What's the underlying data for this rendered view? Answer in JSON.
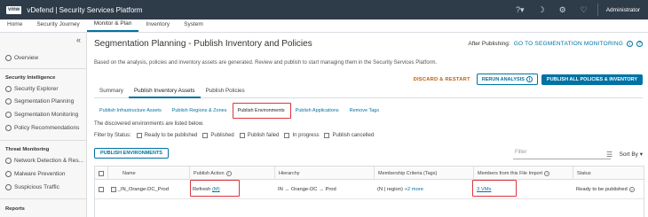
{
  "topbar": {
    "logo": "vmw",
    "title": "vDefend | Security Services Platform",
    "user": "Administrator"
  },
  "nav": {
    "tabs": [
      "Home",
      "Security Journey",
      "Monitor & Plan",
      "Inventory",
      "System"
    ],
    "active": "Monitor & Plan"
  },
  "sidebar": {
    "collapse": "«",
    "overview": "Overview",
    "section1": "Security Intelligence",
    "items1": [
      "Security Explorer",
      "Segmentation Planning",
      "Segmentation Monitoring",
      "Policy Recommendations"
    ],
    "section2": "Threat Monitoring",
    "items2": [
      "Network Detection & Res...",
      "Malware Prevention",
      "Suspicious Traffic"
    ],
    "section3": "Reports"
  },
  "page": {
    "title": "Segmentation Planning - Publish Inventory and Policies",
    "after_label": "After Publishing:",
    "after_link": "GO TO SEGMENTATION MONITORING",
    "description": "Based on the analysis, policies and inventory assets are generated. Review and publish to start managing them in the Security Services Platform.",
    "discard": "DISCARD & RESTART",
    "rerun": "RERUN ANALYSIS",
    "publish_all": "PUBLISH ALL POLICIES & INVENTORY",
    "tabs": [
      "Summary",
      "Publish Inventory Assets",
      "Publish Policies"
    ],
    "subtabs": [
      "Publish Infrastructure Assets",
      "Publish Regions & Zones",
      "Publish Environments",
      "Publish Applications",
      "Remove Tags"
    ],
    "listed": "The discovered environments are listed below.",
    "filter_label": "Filter by Status:",
    "filters": [
      "Ready to be published",
      "Published",
      "Publish failed",
      "In progress",
      "Publish cancelled"
    ],
    "publish_env": "PUBLISH ENVIRONMENTS",
    "filter_placeholder": "Filter",
    "sort_by": "Sort By"
  },
  "table": {
    "headers": [
      "Name",
      "Publish Action",
      "Hierarchy",
      "Membership Criteria (Tags)",
      "Members from this File Import",
      "Status"
    ],
    "row": {
      "name": "_IN_Orange-DC_Prod",
      "action": "Refresh",
      "action_link": "(M)",
      "hierarchy": "IN → Orange-DC → Prod",
      "criteria": "(N | region)",
      "criteria_more": "+2 more",
      "members": "3 VMs",
      "status": "Ready to be published"
    }
  }
}
